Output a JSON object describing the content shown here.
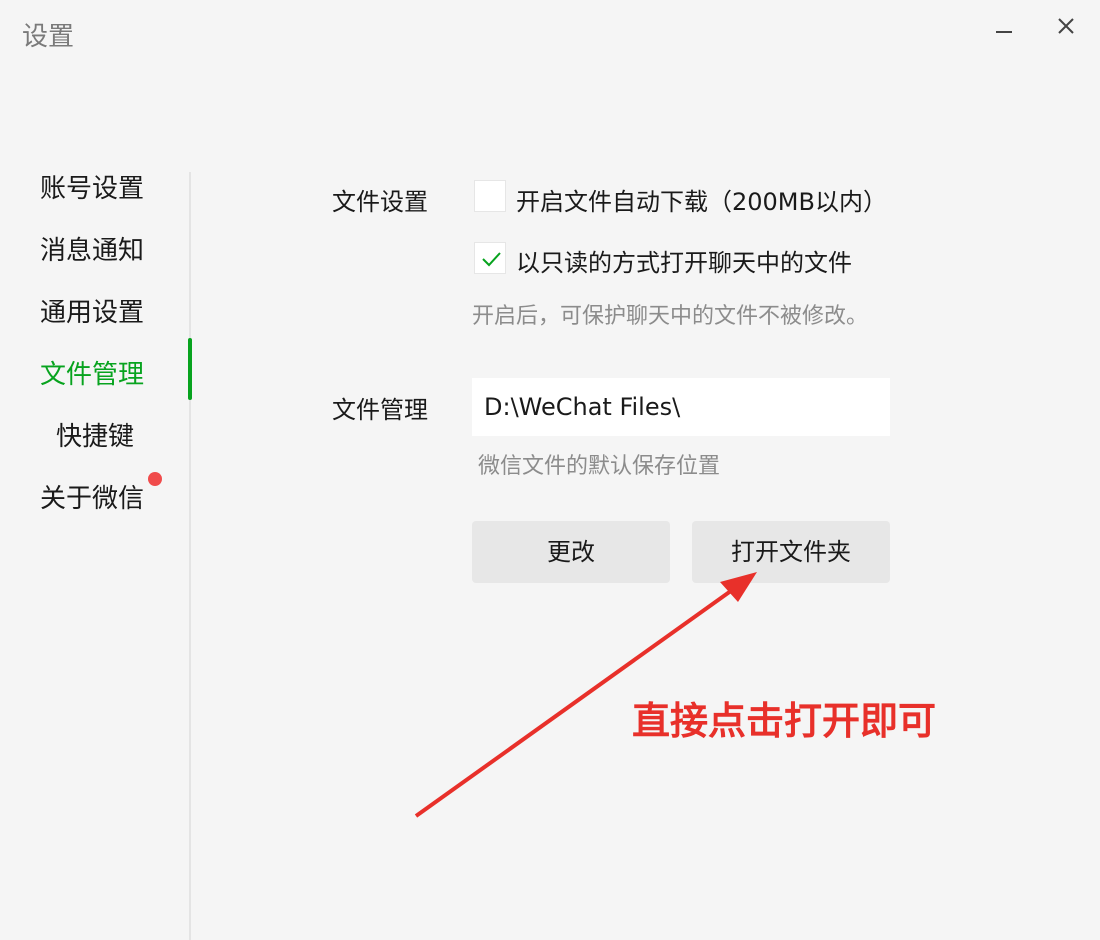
{
  "window": {
    "title": "设置"
  },
  "sidebar": {
    "items": [
      {
        "label": "账号设置"
      },
      {
        "label": "消息通知"
      },
      {
        "label": "通用设置"
      },
      {
        "label": "文件管理",
        "active": true
      },
      {
        "label": "快捷键"
      },
      {
        "label": "关于微信",
        "badge": "red-dot"
      }
    ]
  },
  "file_settings": {
    "section_label": "文件设置",
    "auto_download": {
      "label": "开启文件自动下载（200MB以内）",
      "checked": false
    },
    "read_only": {
      "label": "以只读的方式打开聊天中的文件",
      "checked": true
    },
    "read_only_hint": "开启后，可保护聊天中的文件不被修改。"
  },
  "file_management": {
    "section_label": "文件管理",
    "path_value": "D:\\WeChat Files\\",
    "path_hint": "微信文件的默认保存位置",
    "change_button": "更改",
    "open_folder_button": "打开文件夹"
  },
  "annotation": {
    "text": "直接点击打开即可"
  },
  "colors": {
    "accent": "#07a31e",
    "annotation": "#e8302a",
    "badge": "#f04b4b"
  }
}
